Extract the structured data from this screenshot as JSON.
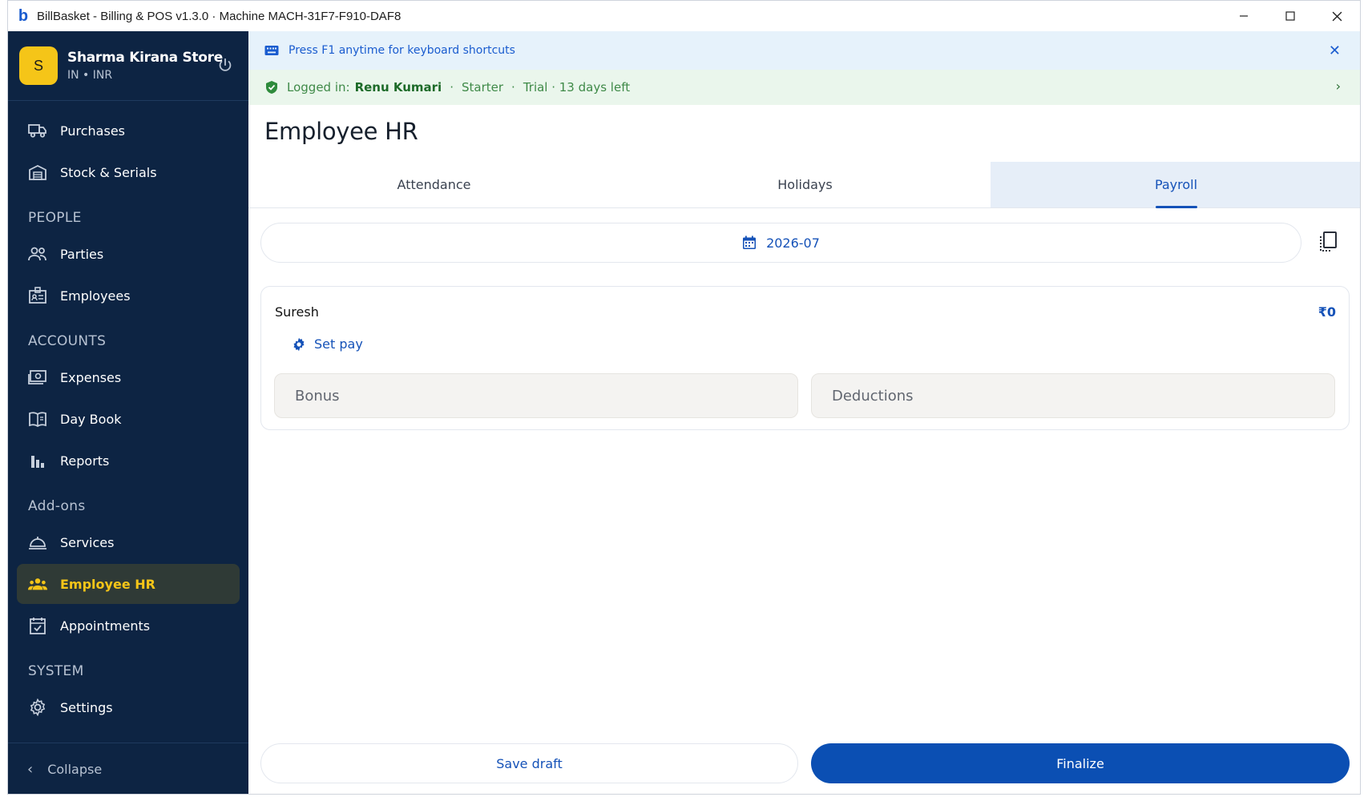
{
  "window": {
    "title": "BillBasket - Billing & POS  v1.3.0  ·  Machine MACH-31F7-F910-DAF8",
    "logo": "b"
  },
  "sidebar": {
    "store_avatar": "S",
    "store_name": "Sharma Kirana Store",
    "store_sub": "IN • INR",
    "items": [
      {
        "label": "Purchases",
        "icon": "truck-icon"
      },
      {
        "label": "Stock & Serials",
        "icon": "warehouse-icon"
      },
      {
        "section": "PEOPLE"
      },
      {
        "label": "Parties",
        "icon": "people-icon"
      },
      {
        "label": "Employees",
        "icon": "badge-icon"
      },
      {
        "section": "ACCOUNTS"
      },
      {
        "label": "Expenses",
        "icon": "money-icon"
      },
      {
        "label": "Day Book",
        "icon": "book-icon"
      },
      {
        "label": "Reports",
        "icon": "bar-chart-icon"
      },
      {
        "section": "Add-ons"
      },
      {
        "label": "Services",
        "icon": "service-bell-icon"
      },
      {
        "label": "Employee HR",
        "icon": "groups-icon",
        "active": true
      },
      {
        "label": "Appointments",
        "icon": "calendar-check-icon"
      },
      {
        "section": "SYSTEM"
      },
      {
        "label": "Settings",
        "icon": "gear-icon"
      }
    ],
    "collapse_label": "Collapse"
  },
  "banners": {
    "info_text": "Press F1 anytime for keyboard shortcuts",
    "login_prefix": "Logged in:",
    "login_user": "Renu Kumari",
    "plan": "Starter",
    "trial": "Trial · 13 days left"
  },
  "page": {
    "title": "Employee HR",
    "tabs": [
      "Attendance",
      "Holidays",
      "Payroll"
    ],
    "active_tab": "Payroll",
    "month": "2026-07"
  },
  "payroll": {
    "employee_name": "Suresh",
    "amount": "₹0",
    "set_pay_label": "Set pay",
    "bonus_placeholder": "Bonus",
    "deductions_placeholder": "Deductions"
  },
  "actions": {
    "save_draft": "Save draft",
    "finalize": "Finalize"
  },
  "colors": {
    "sidebar_bg": "#0d2443",
    "accent_yellow": "#f5c518",
    "primary_blue": "#0b4fb3",
    "info_banner_bg": "#e6f2fb",
    "login_banner_bg": "#eaf6ec"
  }
}
